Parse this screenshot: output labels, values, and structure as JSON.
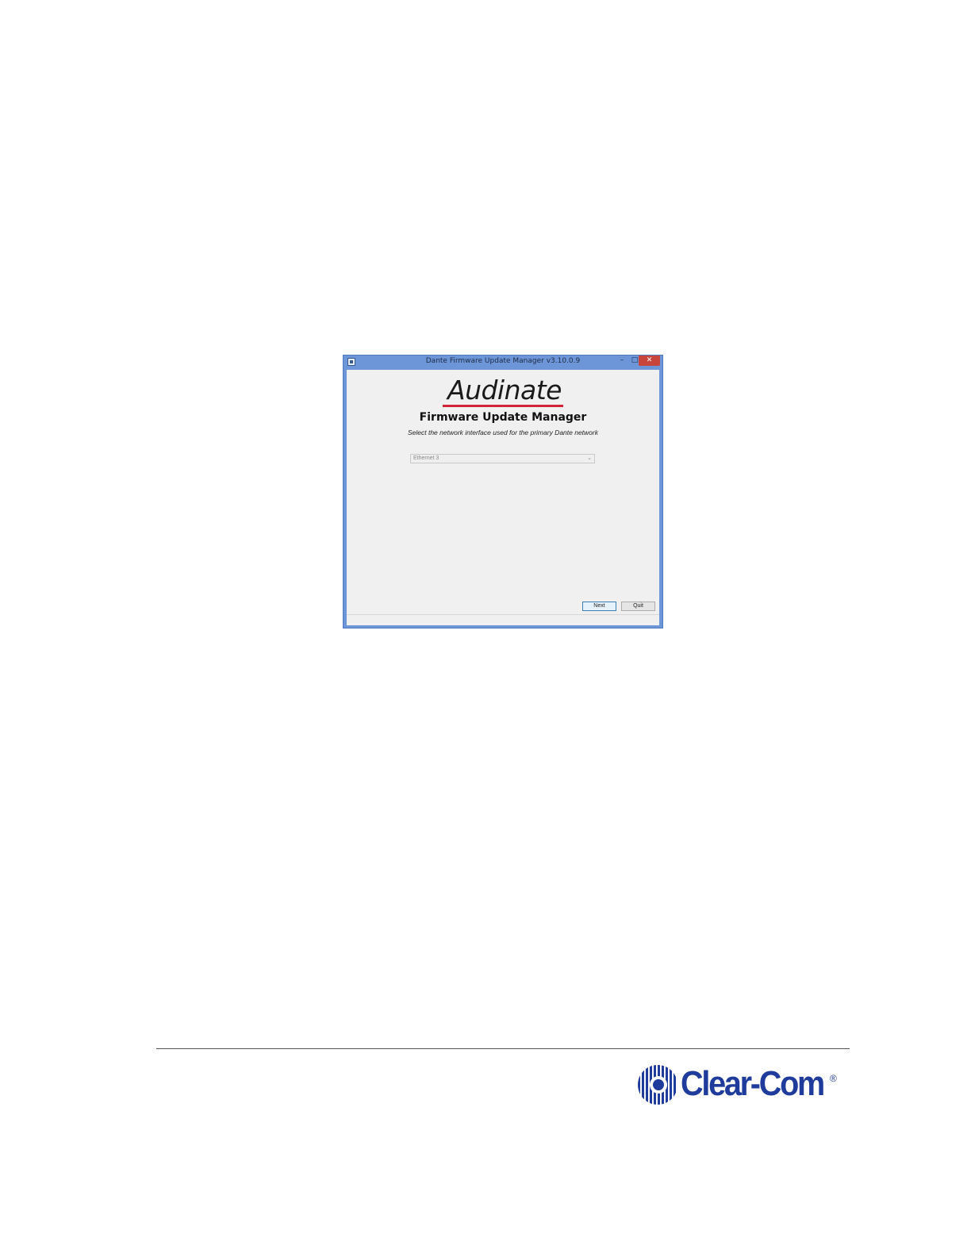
{
  "window": {
    "title": "Dante Firmware Update Manager v3.10.0.9",
    "minimize_glyph": "–",
    "maximize_glyph": "□",
    "close_glyph": "✕"
  },
  "content": {
    "logo_text": "Audinate",
    "app_name": "Firmware Update Manager",
    "instruction": "Select the network interface used for the primary Dante network",
    "network_interface": {
      "selected": "Ethernet 3",
      "chevron_glyph": "⌄"
    },
    "next_label": "Next",
    "quit_label": "Quit"
  },
  "footer": {
    "brand": "Clear-Com",
    "reg_mark": "®"
  },
  "colors": {
    "window_frame": "#6d96d8",
    "close_button": "#c7453b",
    "audinate_red": "#d32338",
    "clearcom_blue": "#1f3b9b"
  }
}
